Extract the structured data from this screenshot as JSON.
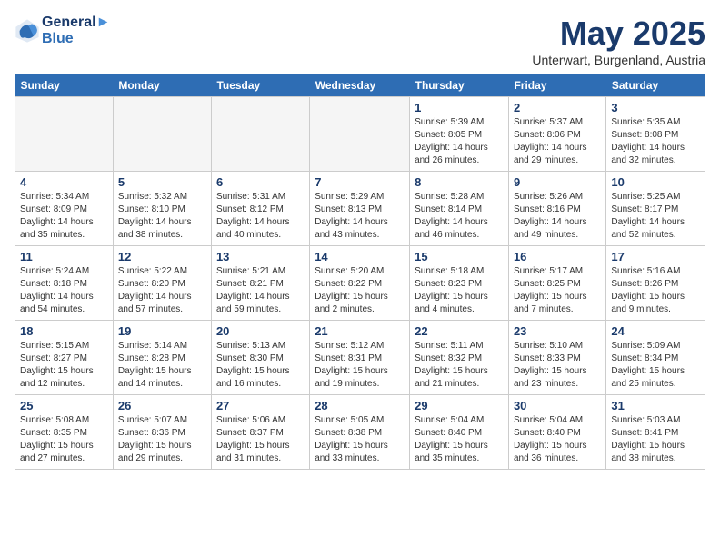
{
  "logo": {
    "line1": "General",
    "line2": "Blue"
  },
  "title": "May 2025",
  "subtitle": "Unterwart, Burgenland, Austria",
  "weekdays": [
    "Sunday",
    "Monday",
    "Tuesday",
    "Wednesday",
    "Thursday",
    "Friday",
    "Saturday"
  ],
  "weeks": [
    [
      {
        "day": "",
        "detail": ""
      },
      {
        "day": "",
        "detail": ""
      },
      {
        "day": "",
        "detail": ""
      },
      {
        "day": "",
        "detail": ""
      },
      {
        "day": "1",
        "detail": "Sunrise: 5:39 AM\nSunset: 8:05 PM\nDaylight: 14 hours\nand 26 minutes."
      },
      {
        "day": "2",
        "detail": "Sunrise: 5:37 AM\nSunset: 8:06 PM\nDaylight: 14 hours\nand 29 minutes."
      },
      {
        "day": "3",
        "detail": "Sunrise: 5:35 AM\nSunset: 8:08 PM\nDaylight: 14 hours\nand 32 minutes."
      }
    ],
    [
      {
        "day": "4",
        "detail": "Sunrise: 5:34 AM\nSunset: 8:09 PM\nDaylight: 14 hours\nand 35 minutes."
      },
      {
        "day": "5",
        "detail": "Sunrise: 5:32 AM\nSunset: 8:10 PM\nDaylight: 14 hours\nand 38 minutes."
      },
      {
        "day": "6",
        "detail": "Sunrise: 5:31 AM\nSunset: 8:12 PM\nDaylight: 14 hours\nand 40 minutes."
      },
      {
        "day": "7",
        "detail": "Sunrise: 5:29 AM\nSunset: 8:13 PM\nDaylight: 14 hours\nand 43 minutes."
      },
      {
        "day": "8",
        "detail": "Sunrise: 5:28 AM\nSunset: 8:14 PM\nDaylight: 14 hours\nand 46 minutes."
      },
      {
        "day": "9",
        "detail": "Sunrise: 5:26 AM\nSunset: 8:16 PM\nDaylight: 14 hours\nand 49 minutes."
      },
      {
        "day": "10",
        "detail": "Sunrise: 5:25 AM\nSunset: 8:17 PM\nDaylight: 14 hours\nand 52 minutes."
      }
    ],
    [
      {
        "day": "11",
        "detail": "Sunrise: 5:24 AM\nSunset: 8:18 PM\nDaylight: 14 hours\nand 54 minutes."
      },
      {
        "day": "12",
        "detail": "Sunrise: 5:22 AM\nSunset: 8:20 PM\nDaylight: 14 hours\nand 57 minutes."
      },
      {
        "day": "13",
        "detail": "Sunrise: 5:21 AM\nSunset: 8:21 PM\nDaylight: 14 hours\nand 59 minutes."
      },
      {
        "day": "14",
        "detail": "Sunrise: 5:20 AM\nSunset: 8:22 PM\nDaylight: 15 hours\nand 2 minutes."
      },
      {
        "day": "15",
        "detail": "Sunrise: 5:18 AM\nSunset: 8:23 PM\nDaylight: 15 hours\nand 4 minutes."
      },
      {
        "day": "16",
        "detail": "Sunrise: 5:17 AM\nSunset: 8:25 PM\nDaylight: 15 hours\nand 7 minutes."
      },
      {
        "day": "17",
        "detail": "Sunrise: 5:16 AM\nSunset: 8:26 PM\nDaylight: 15 hours\nand 9 minutes."
      }
    ],
    [
      {
        "day": "18",
        "detail": "Sunrise: 5:15 AM\nSunset: 8:27 PM\nDaylight: 15 hours\nand 12 minutes."
      },
      {
        "day": "19",
        "detail": "Sunrise: 5:14 AM\nSunset: 8:28 PM\nDaylight: 15 hours\nand 14 minutes."
      },
      {
        "day": "20",
        "detail": "Sunrise: 5:13 AM\nSunset: 8:30 PM\nDaylight: 15 hours\nand 16 minutes."
      },
      {
        "day": "21",
        "detail": "Sunrise: 5:12 AM\nSunset: 8:31 PM\nDaylight: 15 hours\nand 19 minutes."
      },
      {
        "day": "22",
        "detail": "Sunrise: 5:11 AM\nSunset: 8:32 PM\nDaylight: 15 hours\nand 21 minutes."
      },
      {
        "day": "23",
        "detail": "Sunrise: 5:10 AM\nSunset: 8:33 PM\nDaylight: 15 hours\nand 23 minutes."
      },
      {
        "day": "24",
        "detail": "Sunrise: 5:09 AM\nSunset: 8:34 PM\nDaylight: 15 hours\nand 25 minutes."
      }
    ],
    [
      {
        "day": "25",
        "detail": "Sunrise: 5:08 AM\nSunset: 8:35 PM\nDaylight: 15 hours\nand 27 minutes."
      },
      {
        "day": "26",
        "detail": "Sunrise: 5:07 AM\nSunset: 8:36 PM\nDaylight: 15 hours\nand 29 minutes."
      },
      {
        "day": "27",
        "detail": "Sunrise: 5:06 AM\nSunset: 8:37 PM\nDaylight: 15 hours\nand 31 minutes."
      },
      {
        "day": "28",
        "detail": "Sunrise: 5:05 AM\nSunset: 8:38 PM\nDaylight: 15 hours\nand 33 minutes."
      },
      {
        "day": "29",
        "detail": "Sunrise: 5:04 AM\nSunset: 8:40 PM\nDaylight: 15 hours\nand 35 minutes."
      },
      {
        "day": "30",
        "detail": "Sunrise: 5:04 AM\nSunset: 8:40 PM\nDaylight: 15 hours\nand 36 minutes."
      },
      {
        "day": "31",
        "detail": "Sunrise: 5:03 AM\nSunset: 8:41 PM\nDaylight: 15 hours\nand 38 minutes."
      }
    ]
  ]
}
